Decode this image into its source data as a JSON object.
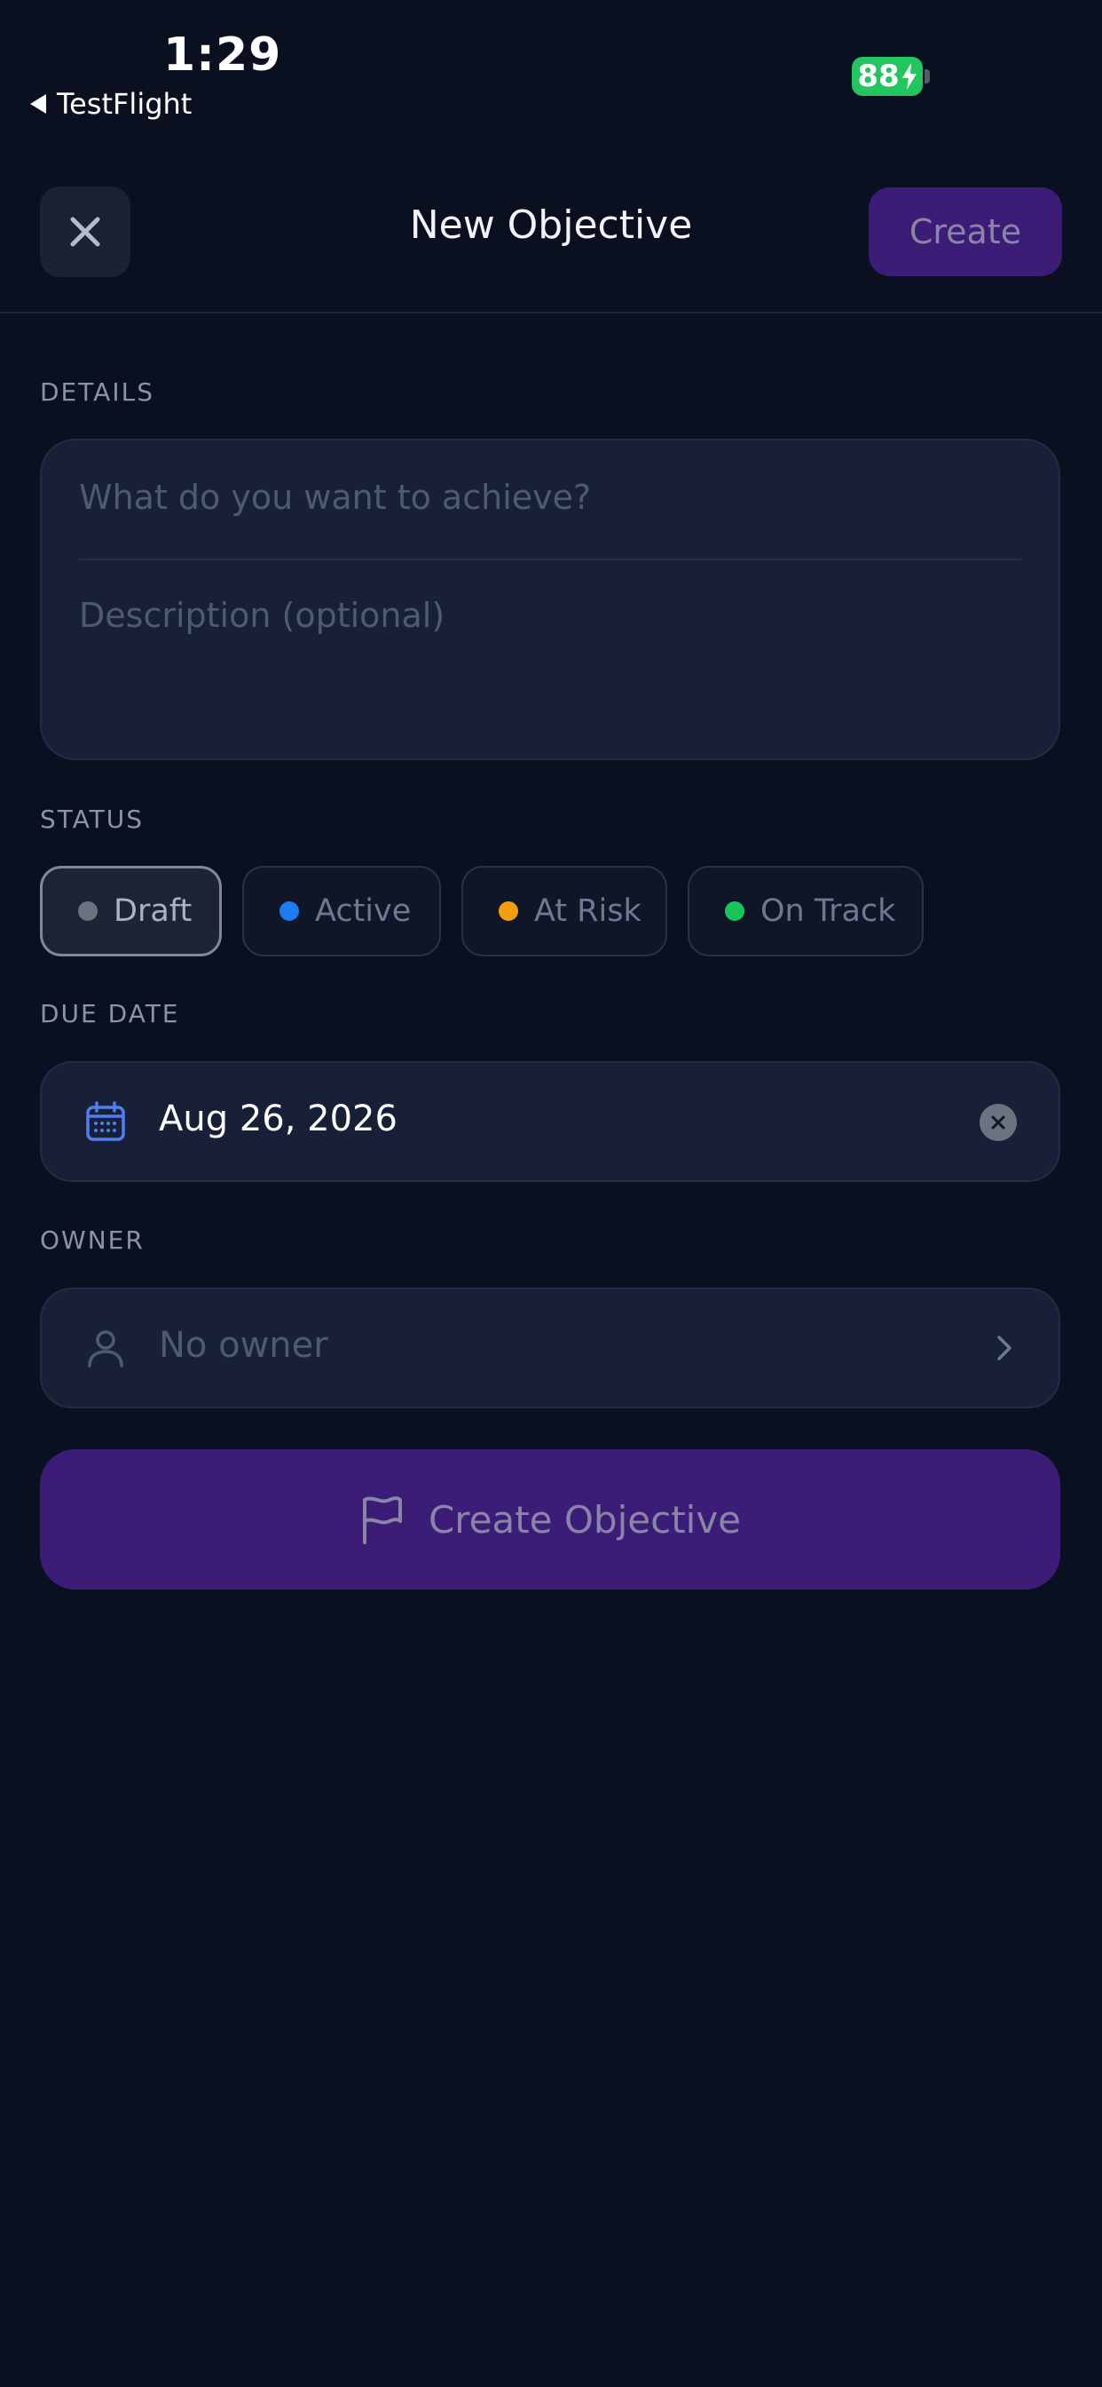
{
  "status_bar": {
    "time": "1:29",
    "back_app": "TestFlight",
    "battery": "88"
  },
  "header": {
    "title": "New Objective",
    "create_label": "Create"
  },
  "details": {
    "section_label": "DETAILS",
    "title_placeholder": "What do you want to achieve?",
    "description_placeholder": "Description (optional)"
  },
  "status": {
    "section_label": "STATUS",
    "selected": "Draft",
    "options": [
      {
        "label": "Draft",
        "color": "#6b7280"
      },
      {
        "label": "Active",
        "color": "#1d7cf2"
      },
      {
        "label": "At Risk",
        "color": "#f59e0b"
      },
      {
        "label": "On Track",
        "color": "#16c55a"
      }
    ]
  },
  "due_date": {
    "section_label": "DUE DATE",
    "value": "Aug 26, 2026",
    "icon": "calendar-icon"
  },
  "owner": {
    "section_label": "OWNER",
    "value": "No owner",
    "icon": "person-icon"
  },
  "primary_action": {
    "label": "Create Objective",
    "icon": "flag-icon"
  },
  "colors": {
    "background": "#0a1020",
    "card": "#172036",
    "accent": "#3b1d78",
    "calendar_blue": "#4f7ef0"
  }
}
